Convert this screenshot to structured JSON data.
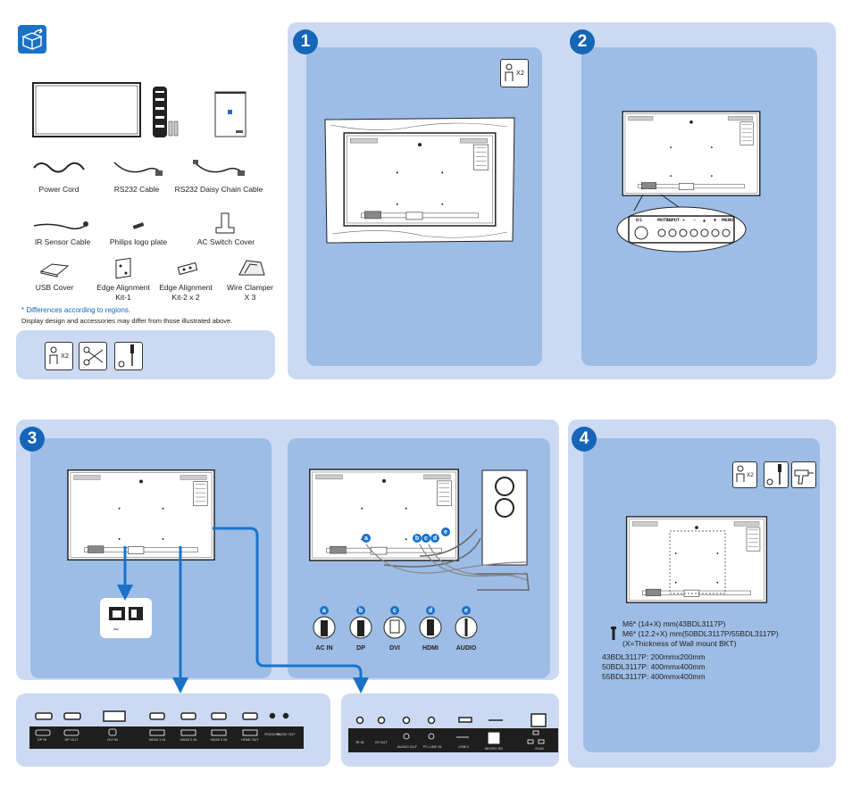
{
  "colors": {
    "outer_panel": "#cbdaf2",
    "inner_panel": "#9dbde6",
    "step_circle": "#1565b8",
    "cable": "#1a72c8",
    "note_text": "#1565b8"
  },
  "header": {
    "icon": "unbox-icon"
  },
  "accessories": {
    "items": [
      {
        "label": "Power Cord",
        "icon": "power-cord-icon"
      },
      {
        "label": "RS232 Cable",
        "icon": "rs232-cable-icon"
      },
      {
        "label": "RS232 Daisy Chain Cable",
        "icon": "daisy-chain-cable-icon"
      },
      {
        "label": "IR Sensor Cable",
        "icon": "ir-sensor-cable-icon"
      },
      {
        "label": "Philips logo plate",
        "icon": "logo-plate-icon"
      },
      {
        "label": "AC Switch Cover",
        "icon": "ac-switch-cover-icon"
      },
      {
        "label": "USB Cover",
        "icon": "usb-cover-icon"
      },
      {
        "label": "Edge Alignment",
        "label2": "Kit-1",
        "icon": "edge-kit-1-icon"
      },
      {
        "label": "Edge Alignment",
        "label2": "Kit-2 x 2",
        "icon": "edge-kit-2-icon"
      },
      {
        "label": "Wire Clamper",
        "label2": "X 3",
        "icon": "wire-clamper-icon"
      }
    ],
    "note_regions": "* Differences according to regions.",
    "note_design": "Display design and accessories may differ from those illustrated above.",
    "tools_people": "X2"
  },
  "steps": {
    "s1": {
      "number": "1",
      "people": "X2"
    },
    "s2": {
      "number": "2",
      "keys": [
        "0/1",
        "MUTE",
        "INPUT",
        "+",
        "−",
        "▲",
        "▼",
        "MENU"
      ]
    },
    "s3": {
      "number": "3",
      "connectors": [
        {
          "letter": "a",
          "label": "AC IN"
        },
        {
          "letter": "b",
          "label": "DP"
        },
        {
          "letter": "c",
          "label": "DVI"
        },
        {
          "letter": "d",
          "label": "HDMI"
        },
        {
          "letter": "e",
          "label": "AUDIO"
        }
      ]
    },
    "s4": {
      "number": "4",
      "people": "X2",
      "screw_lines": [
        "M6* (14+X) mm(43BDL3117P)",
        "M6* (12.2+X) mm(50BDL3117P/55BDL3117P)",
        "(X=Thickness of  Wall mount BKT)"
      ],
      "vesa": [
        "43BDL3117P: 200mmx200mm",
        "50BDL3117P: 400mmx400mm",
        "55BDL3117P: 400mmx400mm"
      ]
    }
  },
  "ports_left": [
    "DP IN",
    "DP OUT",
    "DVI IN",
    "HDMI 1 IN",
    "HDMI 2 IN",
    "HDMI 3 IN",
    "HDMI OUT",
    "RS232 IN",
    "RS232 OUT"
  ],
  "ports_right": [
    "IR IN",
    "IR OUT",
    "AUDIO OUT",
    "PC LINE IN",
    "USB 0",
    "MICRO SD",
    "RJ45"
  ]
}
